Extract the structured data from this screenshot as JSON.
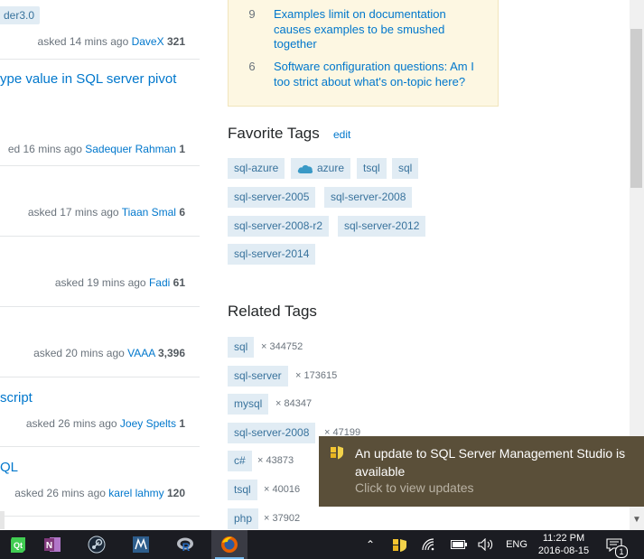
{
  "questions": [
    {
      "tag": "der3.0",
      "meta_prefix": "asked 14 mins ago",
      "user": "DaveX",
      "rep": "321"
    },
    {
      "title": "ype value in SQL server pivot",
      "meta_prefix": "ed 16 mins ago",
      "user": "Sadequer Rahman",
      "rep": "1"
    },
    {
      "meta_prefix": "asked 17 mins ago",
      "user": "Tiaan Smal",
      "rep": "6"
    },
    {
      "meta_prefix": "asked 19 mins ago",
      "user": "Fadi",
      "rep": "61"
    },
    {
      "meta_prefix": "asked 20 mins ago",
      "user": "VAAA",
      "rep": "3,396"
    },
    {
      "title": "script",
      "meta_prefix": "asked 26 mins ago",
      "user": "Joey Spelts",
      "rep": "1"
    },
    {
      "title": "QL",
      "meta_prefix": "asked 26 mins ago",
      "user": "karel lahmy",
      "rep": "120"
    }
  ],
  "meta_posts": [
    {
      "count": "9",
      "text": "Examples limit on documentation causes examples to be smushed together"
    },
    {
      "count": "6",
      "text": "Software configuration questions: Am I too strict about what's on-topic here?"
    }
  ],
  "favorite_tags": {
    "heading": "Favorite Tags",
    "edit": "edit",
    "tags": [
      "sql-azure",
      "azure",
      "tsql",
      "sql",
      "sql-server-2005",
      "sql-server-2008",
      "sql-server-2008-r2",
      "sql-server-2012",
      "sql-server-2014"
    ]
  },
  "related_tags": {
    "heading": "Related Tags",
    "multiplier": "×",
    "items": [
      {
        "tag": "sql",
        "count": "344752"
      },
      {
        "tag": "sql-server",
        "count": "173615"
      },
      {
        "tag": "mysql",
        "count": "84347"
      },
      {
        "tag": "sql-server-2008",
        "count": "47199"
      },
      {
        "tag": "c#",
        "count": "43873"
      },
      {
        "tag": "tsql",
        "count": "40016"
      },
      {
        "tag": "php",
        "count": "37902"
      }
    ]
  },
  "notification": {
    "title": "An update to SQL Server Management Studio is available",
    "subtitle": "Click to view updates",
    "icon": "update-shield-icon"
  },
  "taskbar": {
    "apps": [
      "qt-app-icon",
      "onenote-icon",
      "steam-icon",
      "mysql-workbench-icon",
      "r-icon",
      "firefox-icon"
    ],
    "language": "ENG",
    "time": "11:22 PM",
    "date": "2016-08-15",
    "notification_count": "1"
  },
  "colors": {
    "link": "#0077cc",
    "tag_bg": "#e1ecf4",
    "tag_text": "#39739d",
    "meta_bg": "#fdf7e2",
    "toast_bg": "#5a4f39",
    "taskbar_bg": "#1b1c22"
  }
}
